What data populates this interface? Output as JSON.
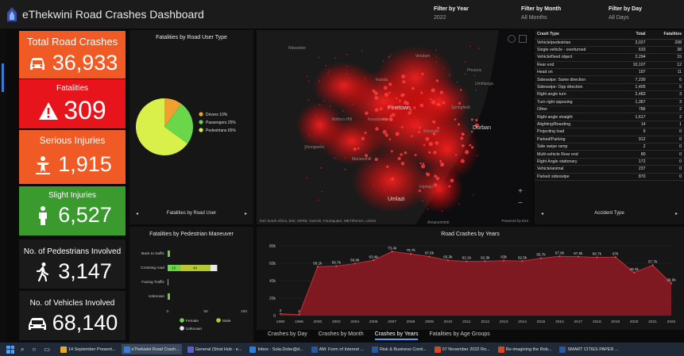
{
  "header": {
    "title": "eThekwini Road Crashes Dashboard",
    "filters": [
      {
        "label": "Filter by Year",
        "value": "2022"
      },
      {
        "label": "Filter by Month",
        "value": "All Months"
      },
      {
        "label": "Filter by Day",
        "value": "All Days"
      }
    ]
  },
  "kpis": [
    {
      "label": "Total Road Crashes",
      "value": "36,933",
      "icon": "car-icon",
      "color": "#f05a24"
    },
    {
      "label": "Fatalities",
      "value": "309",
      "icon": "warning-icon",
      "color": "#e8141b"
    },
    {
      "label": "Serious Injuries",
      "value": "1,915",
      "icon": "injured-person-icon",
      "color": "#f05a24"
    },
    {
      "label": "Slight Injuries",
      "value": "6,527",
      "icon": "person-icon",
      "color": "#3a9a2e"
    },
    {
      "label": "No. of Pedestrians Involved",
      "value": "3,147",
      "icon": "walking-icon",
      "color": "#1a1a1a"
    },
    {
      "label": "No. of Vehicles Involved",
      "value": "68,140",
      "icon": "car-icon",
      "color": "#1a1a1a"
    }
  ],
  "pie_panel": {
    "title": "Fatalities by Road User Type",
    "footer": "Fatalities by Road User",
    "chart_data": {
      "type": "pie",
      "title": "Fatalities by Road User Type",
      "slices": [
        {
          "label": "Drivers",
          "pct_label": "10%",
          "value": 10,
          "color": "#f0a030"
        },
        {
          "label": "Passengers",
          "pct_label": "25%",
          "value": 25,
          "color": "#6ad64a"
        },
        {
          "label": "Pedestrians",
          "pct_label": "65%",
          "value": 65,
          "color": "#d9ef4a"
        }
      ]
    }
  },
  "map": {
    "attribution": "Esri South Africa, Esri, HERE, Garmin, Foursquare, METI/NASA, USGS",
    "powered_by": "Powered by Esri",
    "labels": [
      "Ndwedwe",
      "Verulam",
      "Phoenix",
      "Pinetown",
      "Kwadabeka",
      "Springfield",
      "Durban",
      "Umlazi",
      "Amanzimtoti",
      "Shongweni",
      "Westville",
      "Isipingo",
      "Umhlanga",
      "Botha's Hill",
      "Inanda",
      "Mariannhill"
    ],
    "zoom_in": "+",
    "zoom_out": "−"
  },
  "crash_table": {
    "headers": [
      "Crash Type",
      "Total",
      "Fatalities"
    ],
    "rows": [
      [
        "Vehicle/pedestrian",
        "3,027",
        "208"
      ],
      [
        "Single vehicle - overturned",
        "633",
        "38"
      ],
      [
        "Vehicle/fixed object",
        "2,294",
        "15"
      ],
      [
        "Rear end",
        "10,107",
        "12"
      ],
      [
        "Head on",
        "197",
        "11"
      ],
      [
        "Sideswipe: Same direction",
        "7,230",
        "6"
      ],
      [
        "Sideswipe: Opp direction",
        "1,405",
        "5"
      ],
      [
        "Right angle turn",
        "2,483",
        "3"
      ],
      [
        "Turn right opposing",
        "1,367",
        "3"
      ],
      [
        "Other",
        "786",
        "2"
      ],
      [
        "Right angle straight",
        "1,617",
        "2"
      ],
      [
        "Alighting/Boarding",
        "14",
        "1"
      ],
      [
        "Projecting load",
        "9",
        "0"
      ],
      [
        "Parked/Parking",
        "912",
        "0"
      ],
      [
        "Side swipe ramp",
        "2",
        "0"
      ],
      [
        "Multi-vehicle Rear end",
        "80",
        "0"
      ],
      [
        "Right Angle stationary",
        "172",
        "0"
      ],
      [
        "Vehicle/animal",
        "237",
        "0"
      ],
      [
        "Parked sideswipe",
        "870",
        "0"
      ]
    ],
    "footer": "Accident Type"
  },
  "bar_panel": {
    "title": "Fatalities by Pedestrian Maneuver",
    "chart_data": {
      "type": "bar",
      "orientation": "horizontal",
      "stacked": true,
      "categories": [
        "Back to traffic",
        "Crossing road",
        "Facing Traffic",
        "Unknown"
      ],
      "series": [
        {
          "name": "Female",
          "color": "#6ad64a",
          "values": [
            2,
            16,
            1,
            2
          ]
        },
        {
          "name": "Male",
          "color": "#b8c830",
          "values": [
            1,
            40,
            0,
            1
          ]
        },
        {
          "name": "Unknown",
          "color": "#e8e8e8",
          "values": [
            0,
            9,
            0,
            0
          ]
        }
      ],
      "bar_labels": [
        "",
        "16",
        "40",
        ""
      ],
      "xticks": [
        "0",
        "50",
        "100"
      ],
      "xlim": [
        0,
        100
      ]
    }
  },
  "area_panel": {
    "title": "Road Crashes by Years",
    "chart_data": {
      "type": "area",
      "title": "Road Crashes by Years",
      "x": [
        1990,
        1998,
        2000,
        2002,
        2004,
        2006,
        2007,
        2008,
        2009,
        2010,
        2011,
        2012,
        2013,
        2014,
        2015,
        2016,
        2017,
        2018,
        2019,
        2020,
        2021,
        2022
      ],
      "values": [
        2000,
        1000,
        56100,
        56700,
        59600,
        63400,
        73400,
        70700,
        67600,
        63300,
        62100,
        62300,
        63000,
        62500,
        65700,
        67900,
        67500,
        66700,
        67000,
        49300,
        57700,
        36900
      ],
      "value_labels": [
        "2",
        "1",
        "56.1k",
        "56.7k",
        "59.6k",
        "63.4k",
        "73.4k",
        "70.7k",
        "67.6k",
        "65.3k",
        "62.1k",
        "62.3k",
        "63k",
        "62.5k",
        "65.7k",
        "67.9k",
        "67.5k",
        "66.7k",
        "67k",
        "49.3k",
        "57.7k",
        "36.9k"
      ],
      "yticks": [
        "0",
        "20k",
        "40k",
        "60k",
        "80k"
      ],
      "ylim": [
        0,
        80000
      ],
      "color": "#8b1a22"
    }
  },
  "tabs": [
    {
      "label": "Crashes by Day",
      "active": false
    },
    {
      "label": "Crashes by Month",
      "active": false
    },
    {
      "label": "Crashes by Years",
      "active": true
    },
    {
      "label": "Fatalities by Age Groups",
      "active": false
    }
  ],
  "taskbar": {
    "items": [
      {
        "label": "14 September Present...",
        "color": "#e8a830"
      },
      {
        "label": "eThekwini Road Crash...",
        "color": "#3a7bd5"
      },
      {
        "label": "General (Strat Hub - e...",
        "color": "#5b5fc7"
      },
      {
        "label": "Inbox - Sola.Dobe@d...",
        "color": "#2b7cd3"
      },
      {
        "label": "AM: Form of Interest ...",
        "color": "#2b579a"
      },
      {
        "label": "Risk & Business Conti...",
        "color": "#2b579a"
      },
      {
        "label": "07 November 2022 Ro...",
        "color": "#d24726"
      },
      {
        "label": "Re-imagining the Rob...",
        "color": "#d24726"
      },
      {
        "label": "SMART CITIES PAPER ...",
        "color": "#2b579a"
      }
    ]
  }
}
